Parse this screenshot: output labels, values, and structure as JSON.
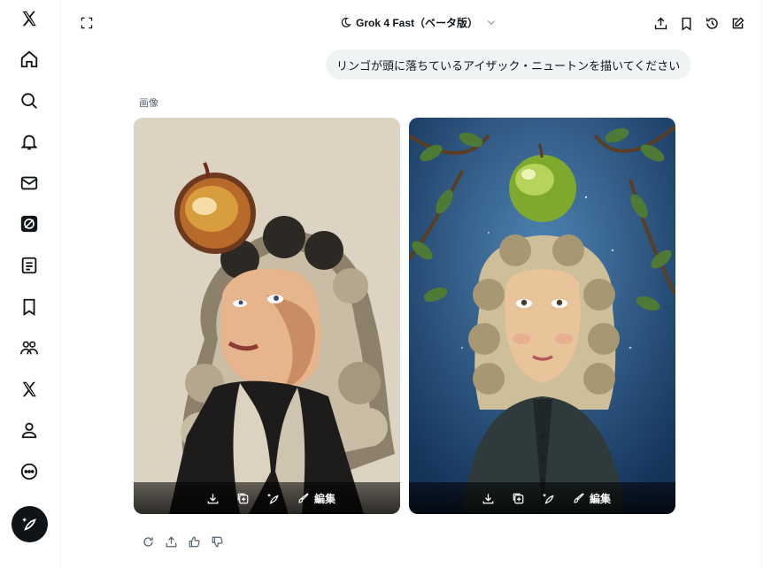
{
  "sidebar": {
    "items": [
      {
        "icon": "x-logo-icon"
      },
      {
        "icon": "home-icon"
      },
      {
        "icon": "search-icon"
      },
      {
        "icon": "bell-icon"
      },
      {
        "icon": "mail-icon"
      },
      {
        "icon": "grok-icon"
      },
      {
        "icon": "list-icon"
      },
      {
        "icon": "bookmark-icon"
      },
      {
        "icon": "communities-icon"
      },
      {
        "icon": "x-premium-icon"
      },
      {
        "icon": "profile-icon"
      },
      {
        "icon": "more-icon"
      }
    ],
    "fab_icon": "grok-compose-icon"
  },
  "header": {
    "model_label": "Grok 4 Fast（ベータ版）",
    "model_icon": "moon-icon",
    "actions": [
      "share-icon",
      "bookmark-icon",
      "history-icon",
      "new-chat-icon"
    ],
    "expand_icon": "expand-icon"
  },
  "conversation": {
    "user_message": "リンゴが頭に落ちているアイザック・ニュートンを描いてください",
    "images_label": "画像",
    "images": [
      {
        "style": "flat illustration",
        "edit_label": "編集"
      },
      {
        "style": "oil painting",
        "edit_label": "編集"
      }
    ],
    "response_actions": [
      "regenerate-icon",
      "share-icon",
      "thumbs-up-icon",
      "thumbs-down-icon"
    ]
  },
  "colors": {
    "accent": "#0f1419",
    "bubble": "#eff3f4",
    "muted": "#536471"
  }
}
